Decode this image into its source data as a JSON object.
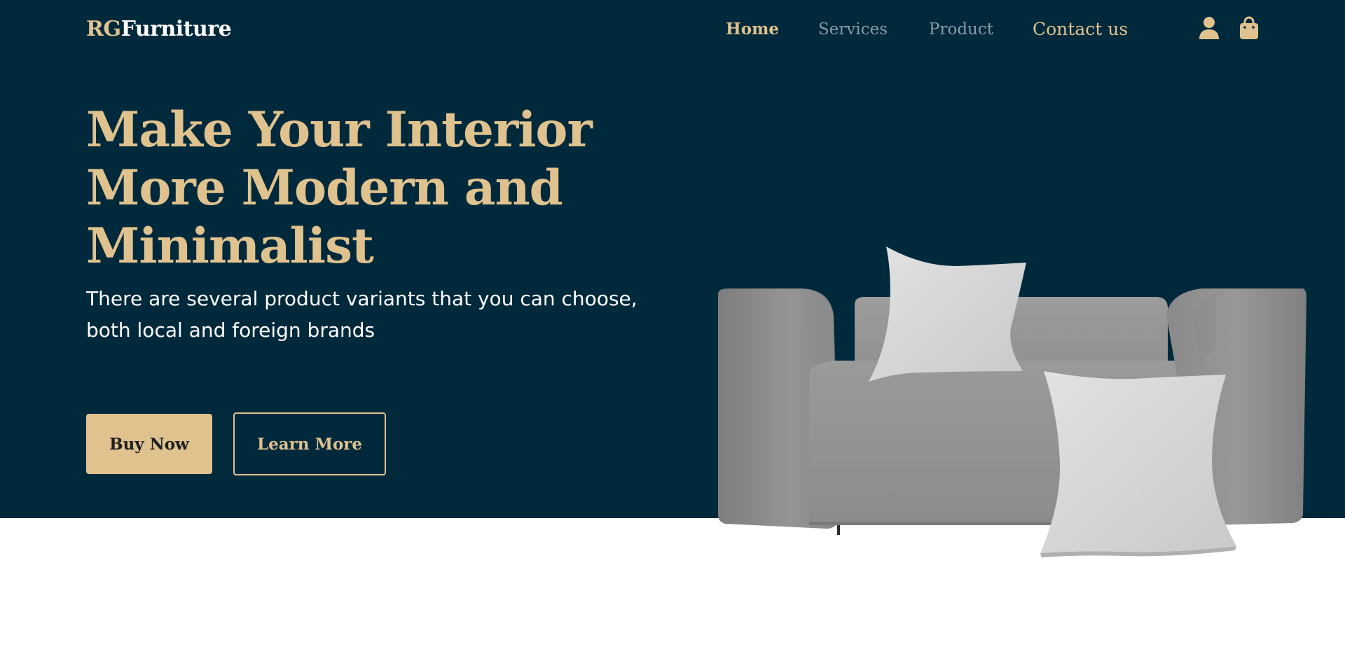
{
  "brand": {
    "prefix": "RG",
    "name": "Furniture"
  },
  "nav": {
    "items": [
      {
        "label": "Home",
        "active": true
      },
      {
        "label": "Services",
        "active": false
      },
      {
        "label": "Product",
        "active": false
      },
      {
        "label": "Contact us",
        "active": false
      }
    ]
  },
  "header_icons": {
    "account": "user-icon",
    "cart": "shopping-bag-icon"
  },
  "hero": {
    "title_lines": [
      "Make Your Interior",
      "More Modern and",
      "Minimalist"
    ],
    "subtitle": "There are several product variants that you can choose, both local and foreign brands",
    "buttons": {
      "primary": "Buy Now",
      "secondary": "Learn More"
    },
    "image": "grey-sofa-with-white-pillows"
  },
  "colors": {
    "background": "#00293c",
    "accent": "#dfc28e",
    "muted_nav": "#8a9aa3",
    "text_light": "#ffffff",
    "button_text_dark": "#1e1f24"
  }
}
